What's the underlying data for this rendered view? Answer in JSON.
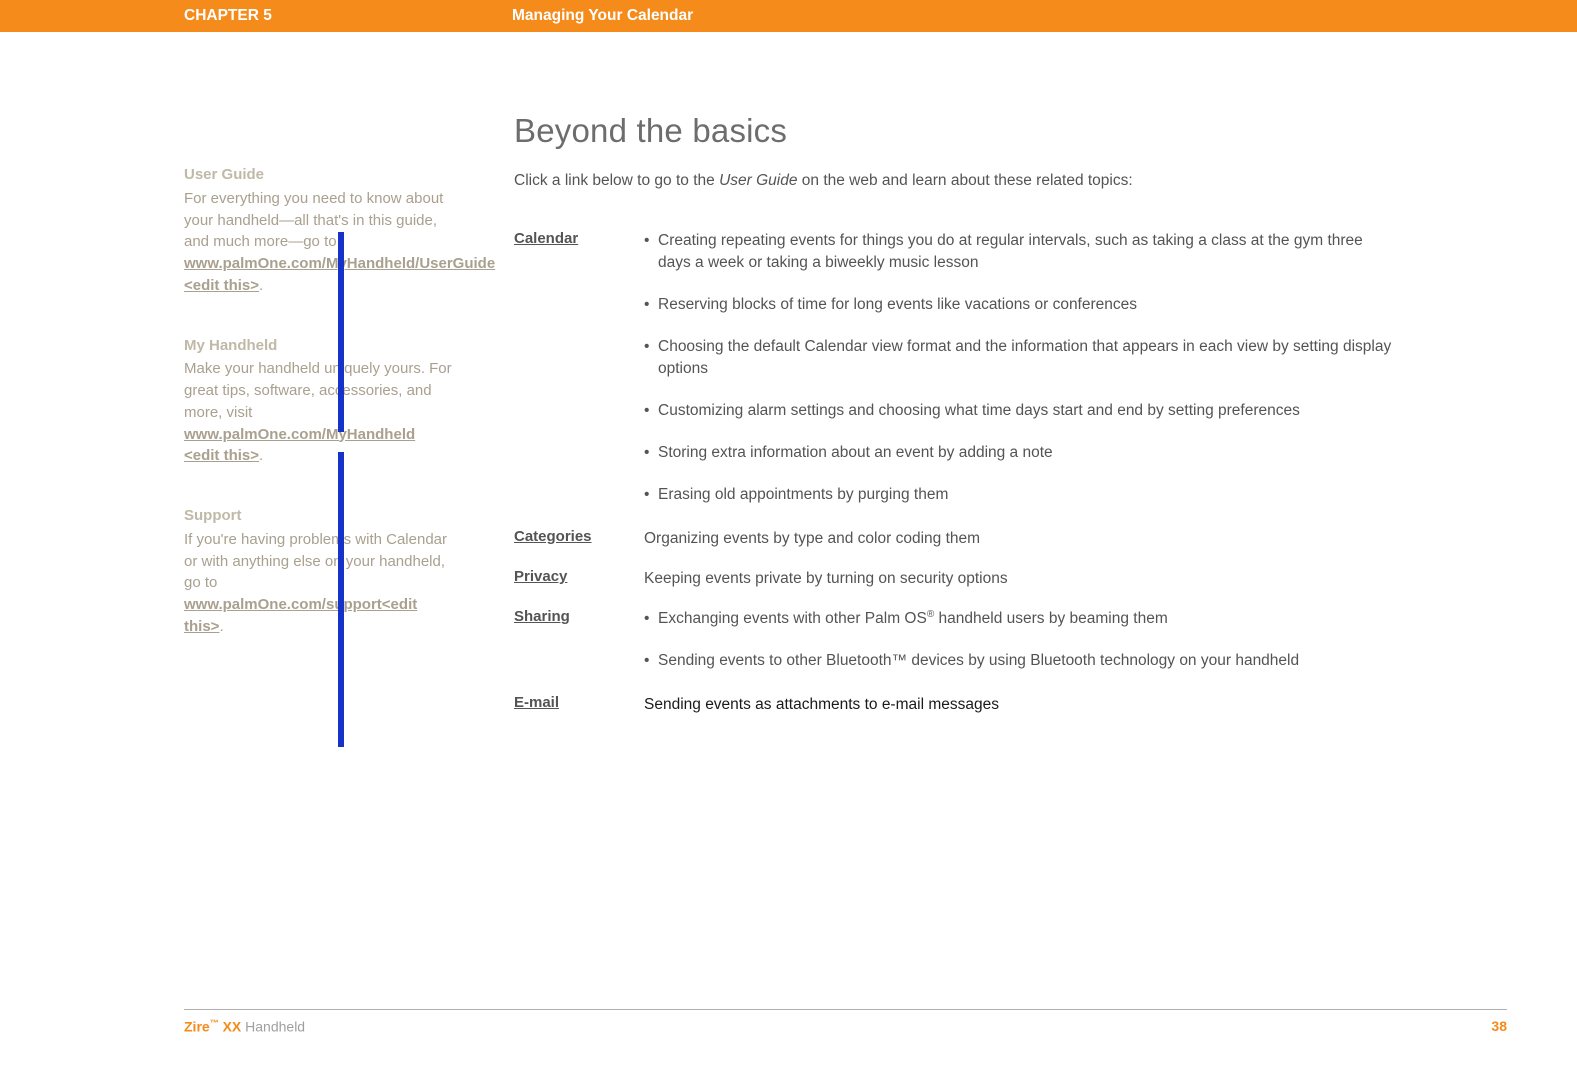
{
  "header": {
    "chapter": "CHAPTER 5",
    "title": "Managing Your Calendar"
  },
  "sidebar": {
    "user_guide": {
      "heading": "User Guide",
      "text_pre": "For everything you need to know about your handheld—all that's in this guide, and much more—go to ",
      "link": "www.palmOne.com/MyHandheld/UserGuide <edit this>",
      "text_post": "."
    },
    "my_handheld": {
      "heading": "My Handheld",
      "text_pre": "Make your handheld uniquely yours. For great tips, software, accessories, and more, visit ",
      "link": "www.palmOne.com/MyHandheld <edit this>",
      "text_post": "."
    },
    "support": {
      "heading": "Support",
      "text_pre": "If you're having problems with Calendar or with anything else on your handheld, go to ",
      "link": "www.palmOne.com/support<edit this>",
      "text_post": "."
    }
  },
  "content": {
    "title": "Beyond the basics",
    "intro_pre": "Click a link below to go to the ",
    "intro_em": "User Guide",
    "intro_post": " on the web and learn about these related topics:",
    "topics": {
      "calendar": {
        "label": "Calendar",
        "items": [
          "Creating repeating events for things you do at regular intervals, such as taking a class at the gym three days a week or taking a biweekly music lesson",
          "Reserving blocks of time for long events like vacations or conferences",
          "Choosing the default Calendar view format and the information that appears in each view by setting display options",
          "Customizing alarm settings and choosing what time days start and end by setting preferences",
          "Storing extra information about an event by adding a note",
          "Erasing old appointments by purging them"
        ]
      },
      "categories": {
        "label": "Categories",
        "text": "Organizing events by type and color coding them"
      },
      "privacy": {
        "label": "Privacy",
        "text": "Keeping events private by turning on security options"
      },
      "sharing": {
        "label": "Sharing",
        "item1_pre": "Exchanging events with other Palm OS",
        "item1_post": " handheld users by beaming them",
        "item2": "Sending events to other Bluetooth™ devices by using Bluetooth technology on your handheld"
      },
      "email": {
        "label": "E-mail",
        "text": "Sending events as attachments to e-mail messages"
      }
    }
  },
  "footer": {
    "brand": "Zire",
    "tm": "™",
    "model": " XX",
    "suffix": " Handheld",
    "page": "38"
  }
}
